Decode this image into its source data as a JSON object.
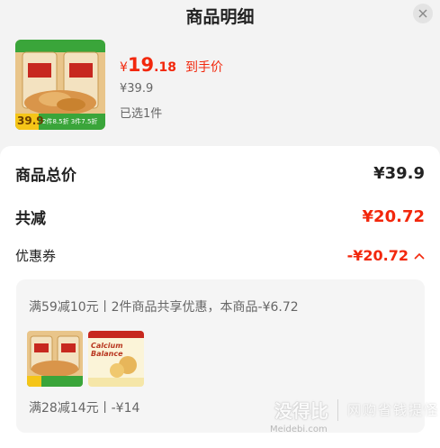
{
  "header": {
    "title": "商品明细"
  },
  "product": {
    "image_badge_price": "39.9",
    "image_badge_deals": "2件8.5折  3件7.5折",
    "price_symbol": "¥",
    "price_int": "19",
    "price_dec": ".18",
    "price_label": "到手价",
    "original_price": "¥39.9",
    "selected_count": "已选1件"
  },
  "summary": {
    "total_label": "商品总价",
    "total_value": "¥39.9",
    "discount_label": "共减",
    "discount_value": "¥20.72",
    "coupon_label": "优惠券",
    "coupon_value": "-¥20.72"
  },
  "coupons": {
    "rule1": "满59减10元丨2件商品共享优惠，本商品-¥6.72",
    "rule2": "满28减14元丨-¥14",
    "thumb2_text": "Calcium Balance"
  },
  "watermark": {
    "main": "没得比",
    "slogan": "网购省钱提怪",
    "url": "Meidebi.com"
  },
  "colors": {
    "accent_red": "#f2270c",
    "badge_yellow": "#f5c518",
    "badge_green": "#3aa53a"
  }
}
